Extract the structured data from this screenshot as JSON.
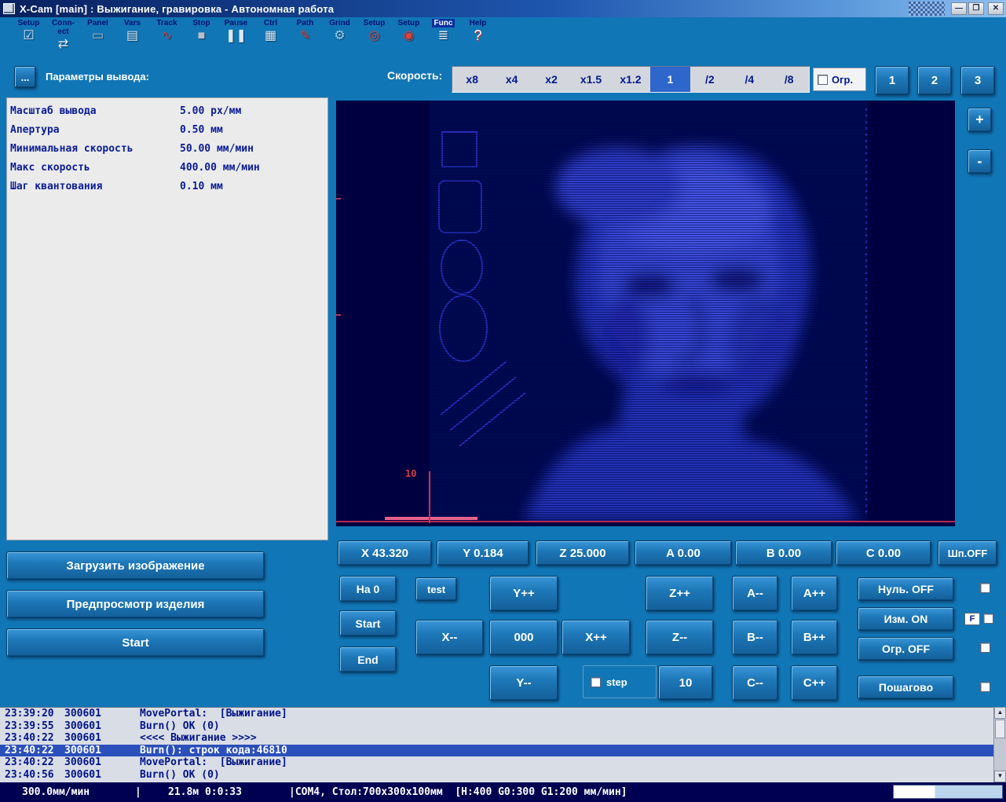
{
  "colors": {
    "window_bg": "#1176b6",
    "accent_selected": "#2e66cc",
    "navy_text": "#001a8c",
    "preview_bg": "#000041",
    "status_bg": "#000052",
    "log_selected_bg": "#2b50bb",
    "red_marker": "#c22b50"
  },
  "window": {
    "title": "X-Cam [main] : Выжигание, гравировка  - Автономная работа",
    "minimize": "—",
    "maximize": "❐",
    "close": "✕"
  },
  "toolbar": [
    {
      "label": "Setup",
      "icon": "setup-checklist-icon",
      "glyph": "☑"
    },
    {
      "label": "Conn-ect",
      "icon": "connect-icon",
      "glyph": "⇄"
    },
    {
      "label": "Panel",
      "icon": "panel-icon",
      "glyph": "▭"
    },
    {
      "label": "Vars",
      "icon": "vars-table-icon",
      "glyph": "▤"
    },
    {
      "label": "Track",
      "icon": "track-waveform-icon",
      "glyph": "∿"
    },
    {
      "label": "Stop",
      "icon": "stop-icon",
      "glyph": "■"
    },
    {
      "label": "Pause",
      "icon": "pause-icon",
      "glyph": "❚❚"
    },
    {
      "label": "Ctrl",
      "icon": "ctrl-keypad-icon",
      "glyph": "▦"
    },
    {
      "label": "Path",
      "icon": "path-pen-icon",
      "glyph": "✎"
    },
    {
      "label": "Grind",
      "icon": "grind-tool-icon",
      "glyph": "⚙"
    },
    {
      "label": "Setup",
      "icon": "setup-disc-icon",
      "glyph": "◎"
    },
    {
      "label": "Setup",
      "icon": "setup-disc2-icon",
      "glyph": "◉"
    },
    {
      "label": "Func",
      "icon": "func-list-icon",
      "glyph": "≣"
    },
    {
      "label": "Help",
      "icon": "help-icon",
      "glyph": "?"
    }
  ],
  "speed": {
    "label": "Скорость:",
    "options": [
      "x8",
      "x4",
      "x2",
      "x1.5",
      "x1.2",
      "1",
      "/2",
      "/4",
      "/8"
    ],
    "selected_index": 5,
    "limit": {
      "label": "Огр.",
      "checked": false
    },
    "presets": [
      "1",
      "2",
      "3"
    ]
  },
  "params": {
    "more_button": "...",
    "title": "Параметры вывода:",
    "rows": [
      {
        "label": "Масштаб вывода",
        "value": "5.00 px/мм"
      },
      {
        "label": "Апертура",
        "value": "0.50 мм"
      },
      {
        "label": "Минимальная скорость",
        "value": "50.00 мм/мин"
      },
      {
        "label": "Макс скорость",
        "value": "400.00 мм/мин"
      },
      {
        "label": "Шаг квантования",
        "value": "0.10 мм"
      }
    ]
  },
  "preview": {
    "ruler_label": "10",
    "zoom_in": "+",
    "zoom_out": "-"
  },
  "axes": {
    "x": "X 43.320",
    "y": "Y 0.184",
    "z": "Z 25.000",
    "a": "A 0.00",
    "b": "B 0.00",
    "c": "C 0.00",
    "spindle": "Шп.OFF"
  },
  "actions": {
    "load_image": "Загрузить изображение",
    "preview_product": "Предпросмотр изделия",
    "start": "Start"
  },
  "jog": {
    "na0": "На 0",
    "test": "test",
    "start": "Start",
    "end": "End",
    "y_plus": "Y++",
    "y_minus": "Y--",
    "x_plus": "X++",
    "x_minus": "X--",
    "zero": "000",
    "z_plus": "Z++",
    "z_minus": "Z--",
    "a_plus": "A++",
    "a_minus": "A--",
    "b_plus": "B++",
    "b_minus": "B--",
    "c_plus": "C++",
    "c_minus": "C--",
    "step_label": "step",
    "step_value": "10",
    "null_off": "Нуль. OFF",
    "izm_on": "Изм. ON",
    "ogr_off": "Огр. OFF",
    "poshagovo": "Пошагово",
    "f_label": "F"
  },
  "log": {
    "entries": [
      {
        "time": "23:39:20",
        "code": "300601",
        "msg": "MovePortal:  [Выжигание]",
        "selected": false
      },
      {
        "time": "23:39:55",
        "code": "300601",
        "msg": "Burn() OK (0)",
        "selected": false
      },
      {
        "time": "23:40:22",
        "code": "300601",
        "msg": "<<<< Выжигание >>>>",
        "selected": false
      },
      {
        "time": "23:40:22",
        "code": "300601",
        "msg": "Burn(): строк кода:46810",
        "selected": true
      },
      {
        "time": "23:40:22",
        "code": "300601",
        "msg": "MovePortal:  [Выжигание]",
        "selected": false
      },
      {
        "time": "23:40:56",
        "code": "300601",
        "msg": "Burn() OK (0)",
        "selected": false
      }
    ]
  },
  "status": {
    "feed": "300.0мм/мин",
    "sep": "|",
    "job": "21.8м 0:0:33",
    "port": "|COM4, Стол:700x300x100мм  [H:400 G0:300 G1:200 мм/мин]"
  }
}
